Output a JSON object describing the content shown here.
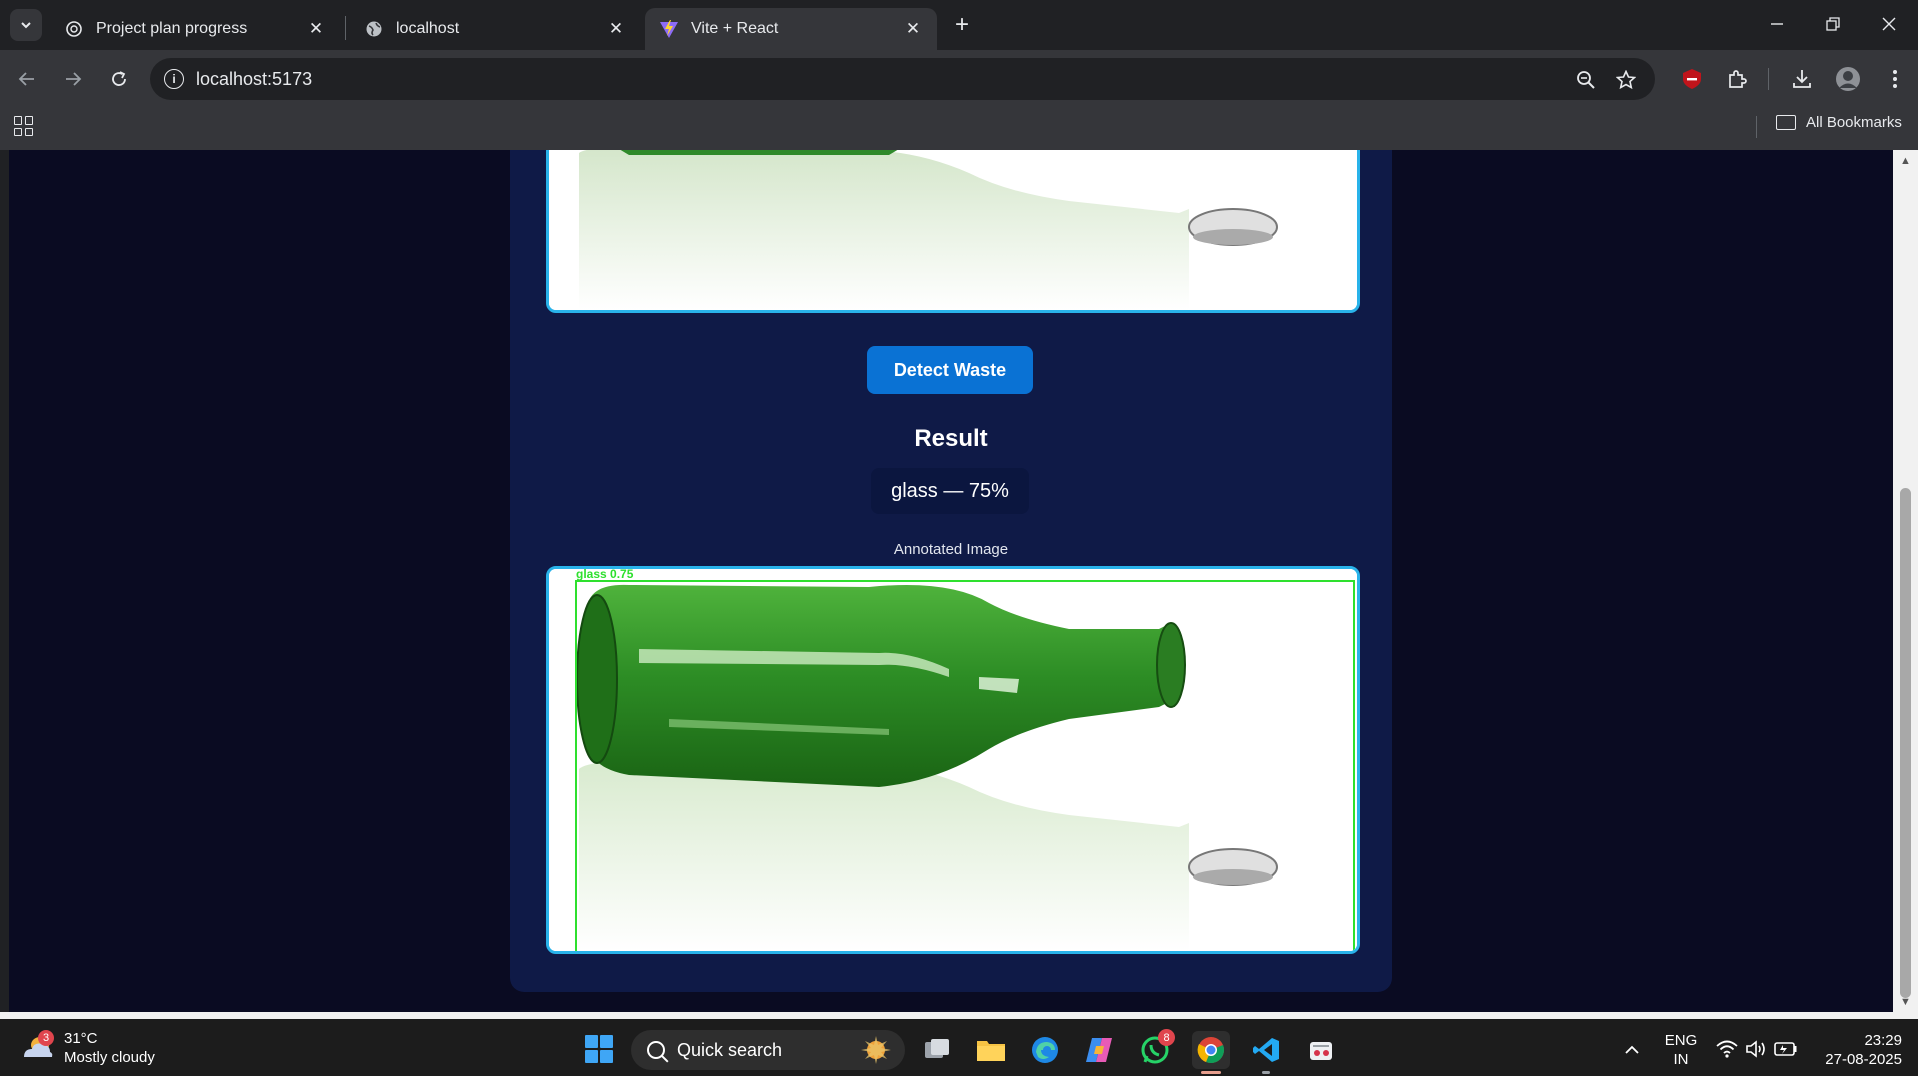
{
  "browser": {
    "tabs": [
      {
        "label": "Project plan progress",
        "icon": "chatgpt-icon",
        "active": false
      },
      {
        "label": "localhost",
        "icon": "globe-icon",
        "active": false
      },
      {
        "label": "Vite + React",
        "icon": "vite-icon",
        "active": true
      }
    ],
    "address": "localhost:5173",
    "all_bookmarks_label": "All Bookmarks"
  },
  "page": {
    "detect_button_label": "Detect Waste",
    "result_heading": "Result",
    "result_text": "glass — 75%",
    "annotated_label": "Annotated Image",
    "detection_box_label": "glass  0.75"
  },
  "colors": {
    "page_bg": "#0a0b22",
    "card_bg": "#0f1a47",
    "accent_border": "#29b3ea",
    "button_bg": "#0a72d4",
    "detection_box": "#2ee02e"
  },
  "taskbar": {
    "weather_temp": "31°C",
    "weather_desc": "Mostly cloudy",
    "weather_badge": "3",
    "search_placeholder": "Quick search",
    "whatsapp_badge": "8",
    "lang_top": "ENG",
    "lang_bottom": "IN",
    "time": "23:29",
    "date": "27-08-2025"
  }
}
